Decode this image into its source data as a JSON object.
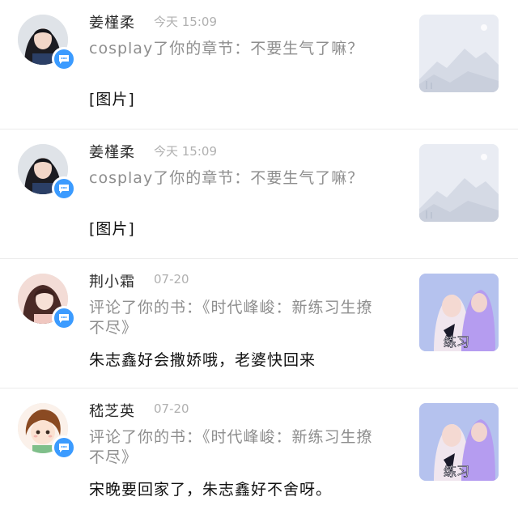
{
  "notifications": [
    {
      "name": "姜槿柔",
      "time": "今天 15:09",
      "action": "cosplay了你的章节：不要生气了嘛？",
      "content": "[图片]",
      "avatar_icon": "user-photo-girl-dark-hair",
      "thumbnail_icon": "image-placeholder-mountains"
    },
    {
      "name": "姜槿柔",
      "time": "今天 15:09",
      "action": "cosplay了你的章节：不要生气了嘛？",
      "content": "[图片]",
      "avatar_icon": "user-photo-girl-dark-hair",
      "thumbnail_icon": "image-placeholder-mountains"
    },
    {
      "name": "荆小霜",
      "time": "07-20",
      "action": "评论了你的书：《时代峰峻：新练习生撩不尽》",
      "content": "朱志鑫好会撒娇哦，老婆快回来",
      "avatar_icon": "user-photo-girl-pink",
      "thumbnail_icon": "book-cover"
    },
    {
      "name": "嵇芝英",
      "time": "07-20",
      "action": "评论了你的书：《时代峰峻：新练习生撩不尽》",
      "content": "宋晚要回家了，朱志鑫好不舍呀。",
      "avatar_icon": "user-avatar-cartoon-girl",
      "thumbnail_icon": "book-cover"
    }
  ],
  "colors": {
    "badge": "#3b9bff",
    "name": "#2a2a2a",
    "time": "#b0b0b0",
    "action": "#8e8e8e",
    "content": "#111111",
    "divider": "#ececec"
  }
}
